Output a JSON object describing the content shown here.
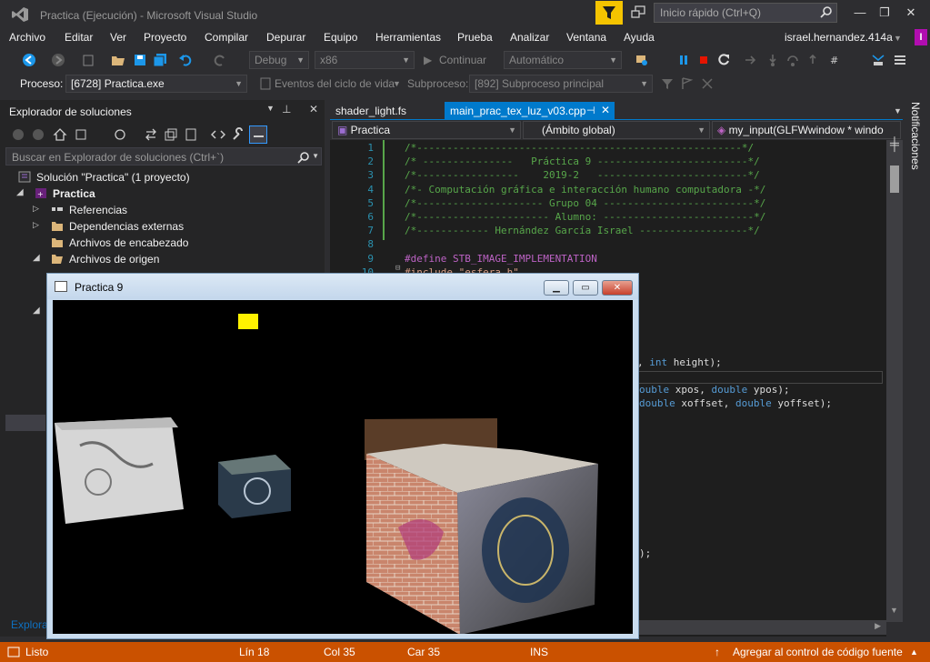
{
  "window": {
    "title": "Practica (Ejecución) - Microsoft Visual Studio",
    "quick_launch_placeholder": "Inicio rápido (Ctrl+Q)",
    "user": "israel.hernandez.414a",
    "user_badge": "I"
  },
  "menu": [
    "Archivo",
    "Editar",
    "Ver",
    "Proyecto",
    "Compilar",
    "Depurar",
    "Equipo",
    "Herramientas",
    "Prueba",
    "Analizar",
    "Ventana",
    "Ayuda"
  ],
  "toolbar": {
    "config": "Debug",
    "platform": "x86",
    "continue": "Continuar",
    "continue_mode": "Automático",
    "process_label": "Proceso:",
    "process": "[6728] Practica.exe",
    "lifecycle": "Eventos del ciclo de vida",
    "thread_label": "Subproceso:",
    "thread": "[892] Subproceso principal"
  },
  "solution_explorer": {
    "title": "Explorador de soluciones",
    "search_placeholder": "Buscar en Explorador de soluciones (Ctrl+`)",
    "solution": "Solución \"Practica\"  (1 proyecto)",
    "project": "Practica",
    "items": [
      "Referencias",
      "Dependencias externas",
      "Archivos de encabezado",
      "Archivos de origen"
    ],
    "footer_tab": "Explora"
  },
  "editor": {
    "tabs": [
      {
        "label": "shader_light.fs",
        "active": false
      },
      {
        "label": "main_prac_tex_luz_v03.cpp",
        "active": true
      }
    ],
    "nav_project": "Practica",
    "nav_scope": "(Ámbito global)",
    "nav_member": "my_input(GLFWwindow * windo",
    "lines": [
      {
        "n": "1",
        "text": "/*------------------------------------------------------*/",
        "cls": "c-green"
      },
      {
        "n": "2",
        "text": "/* ---------------   Práctica 9 -------------------------*/",
        "cls": "c-green"
      },
      {
        "n": "3",
        "text": "/*-----------------    2019-2   -------------------------*/",
        "cls": "c-green"
      },
      {
        "n": "4",
        "text": "/*- Computación gráfica e interacción humano computadora -*/",
        "cls": "c-green"
      },
      {
        "n": "5",
        "text": "/*--------------------- Grupo 04 -------------------------*/",
        "cls": "c-green"
      },
      {
        "n": "6",
        "text": "/*---------------------- Alumno: -------------------------*/",
        "cls": "c-green"
      },
      {
        "n": "7",
        "text": "/*------------ Hernández García Israel ------------------*/",
        "cls": "c-green"
      },
      {
        "n": "8",
        "text": "",
        "cls": "c-white"
      },
      {
        "n": "9",
        "text": "#define STB_IMAGE_IMPLEMENTATION",
        "cls": "c-purple"
      },
      {
        "n": "10",
        "text": "#include \"esfera.h\"",
        "cls": "c-red"
      }
    ],
    "fragments": {
      "frag1_a": ", ",
      "frag1_b": "int",
      "frag1_c": " height);",
      "frag2_a": "ouble",
      "frag2_b": " xpos, ",
      "frag2_c": "double",
      "frag2_d": " ypos);",
      "frag3_a": "double",
      "frag3_b": " xoffset, ",
      "frag3_c": "double",
      "frag3_d": " yoffset);",
      "frag4": ");"
    },
    "notifications": "Notificaciones"
  },
  "gl_window": {
    "title": "Practica 9"
  },
  "status": {
    "ready": "Listo",
    "line": "Lín 18",
    "col": "Col 35",
    "char": "Car 35",
    "mode": "INS",
    "source_control": "Agregar al control de código fuente"
  }
}
